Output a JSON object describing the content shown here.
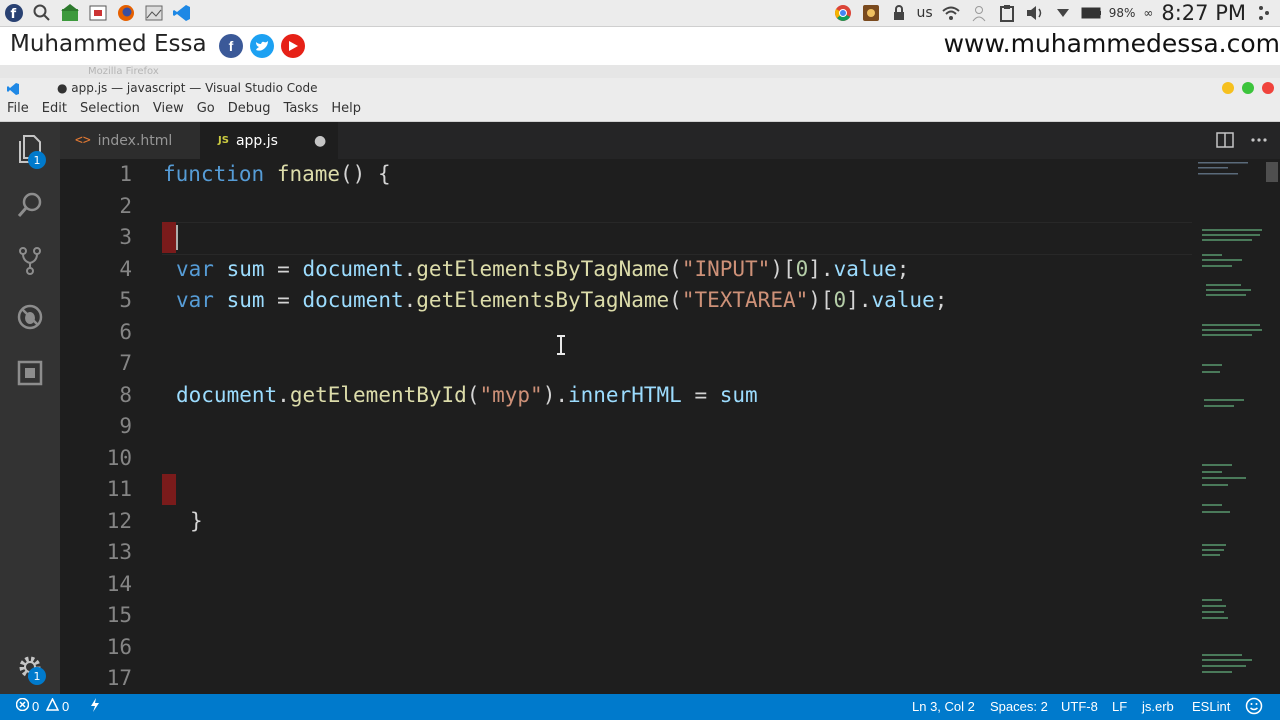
{
  "system_bar": {
    "left_icons": [
      "fedora-icon",
      "search-icon",
      "home-folder-icon",
      "screenshot-icon",
      "firefox-icon",
      "image-viewer-icon",
      "vscode-icon"
    ],
    "keyboard_layout": "us",
    "battery_percent": "98%",
    "battery_suffix": "∞",
    "clock": "8:27 PM"
  },
  "banner": {
    "author": "Muhammed Essa",
    "website": "www.muhammedessa.com",
    "socials": [
      {
        "name": "facebook",
        "glyph": "f",
        "color": "#3b5998"
      },
      {
        "name": "twitter",
        "glyph": "t",
        "color": "#1da1f2"
      },
      {
        "name": "youtube",
        "glyph": "▶",
        "color": "#e62117"
      }
    ]
  },
  "background_window": {
    "title": "Mozilla Firefox"
  },
  "window": {
    "title": "● app.js — javascript — Visual Studio Code",
    "menu": [
      "File",
      "Edit",
      "Selection",
      "View",
      "Go",
      "Debug",
      "Tasks",
      "Help"
    ]
  },
  "activity_bar": {
    "explorer_badge": "1",
    "settings_badge": "1"
  },
  "tabs": [
    {
      "label": "index.html",
      "icon_text": "<>",
      "active": false
    },
    {
      "label": "app.js",
      "icon_text": "JS",
      "active": true,
      "dirty_marker": "●"
    }
  ],
  "editor": {
    "line_numbers": [
      "1",
      "2",
      "3",
      "4",
      "5",
      "6",
      "7",
      "8",
      "9",
      "10",
      "11",
      "12",
      "13",
      "14",
      "15",
      "16",
      "17"
    ],
    "lines": {
      "l1": {
        "kw": "function",
        "fn": "fname",
        "rest": "() {"
      },
      "l4": {
        "kw": "var",
        "v": "sum",
        "eq": " = ",
        "obj": "document",
        "dot": ".",
        "fn": "getElementsByTagName",
        "open": "(",
        "str": "\"INPUT\"",
        "close": ")[",
        "num": "0",
        "close2": "].",
        "prop": "value",
        "end": ";"
      },
      "l5": {
        "kw": "var",
        "v": "sum",
        "eq": " = ",
        "obj": "document",
        "dot": ".",
        "fn": "getElementsByTagName",
        "open": "(",
        "str": "\"TEXTAREA\"",
        "close": ")[",
        "num": "0",
        "close2": "].",
        "prop": "value",
        "end": ";"
      },
      "l8": {
        "obj": "document",
        "dot": ".",
        "fn": "getElementById",
        "open": "(",
        "str": "\"myp\"",
        "close": ").",
        "prop": "innerHTML",
        "eq": " = ",
        "v": "sum"
      },
      "l12": {
        "brace": "}"
      }
    }
  },
  "status_bar": {
    "errors": "0",
    "warnings": "0",
    "position": "Ln 3, Col 2",
    "spaces": "Spaces: 2",
    "encoding": "UTF-8",
    "eol": "LF",
    "language": "js.erb",
    "linter": "ESLint"
  },
  "colors": {
    "accent": "#007acc",
    "keyword": "#569cd6",
    "function": "#dcdcaa",
    "variable": "#9cdcfe",
    "string": "#ce9178",
    "number": "#b5cea8"
  }
}
